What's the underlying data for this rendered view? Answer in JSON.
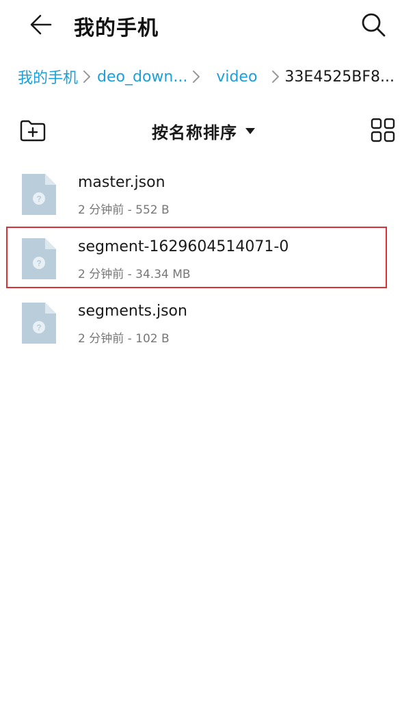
{
  "header": {
    "title": "我的手机",
    "back_icon": "arrow-left-icon",
    "search_icon": "search-icon"
  },
  "breadcrumb": {
    "items": [
      {
        "label": "我的手机"
      },
      {
        "label": "deo_down..."
      },
      {
        "label": "video"
      },
      {
        "label": "33E4525BF8..."
      }
    ]
  },
  "toolbar": {
    "sort_label": "按名称排序",
    "new_folder_icon": "new-folder-icon",
    "view_toggle_icon": "grid-view-icon"
  },
  "files": [
    {
      "name": "master.json",
      "meta": "2 分钟前 - 552 B",
      "selected": false
    },
    {
      "name": "segment-1629604514071-0",
      "meta": "2 分钟前 - 34.34 MB",
      "selected": true
    },
    {
      "name": "segments.json",
      "meta": "2 分钟前 - 102 B",
      "selected": false
    }
  ],
  "colors": {
    "accent": "#1aa0dc",
    "highlight": "#d9303a",
    "file_icon": "#b9cddb"
  }
}
